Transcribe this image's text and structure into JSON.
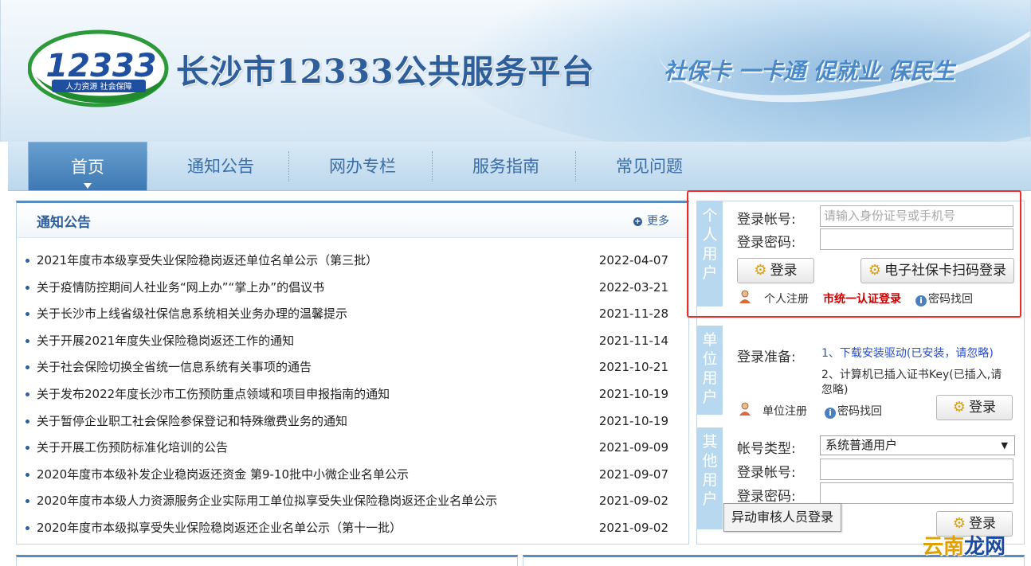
{
  "header": {
    "logo_number": "12333",
    "logo_sub": "人力资源 社会保障",
    "site_title": "长沙市12333公共服务平台",
    "slogan": "社保卡 一卡通 促就业 保民生"
  },
  "nav": {
    "items": [
      {
        "label": "首页",
        "active": true
      },
      {
        "label": "通知公告"
      },
      {
        "label": "网办专栏"
      },
      {
        "label": "服务指南"
      },
      {
        "label": "常见问题"
      }
    ]
  },
  "news": {
    "title": "通知公告",
    "more": "更多",
    "items": [
      {
        "title": "2021年度市本级享受失业保险稳岗返还单位名单公示（第三批）",
        "date": "2022-04-07"
      },
      {
        "title": "关于疫情防控期间人社业务“网上办”“掌上办”的倡议书",
        "date": "2022-03-21"
      },
      {
        "title": "关于长沙市上线省级社保信息系统相关业务办理的温馨提示",
        "date": "2021-11-28"
      },
      {
        "title": "关于开展2021年度失业保险稳岗返还工作的通知",
        "date": "2021-11-14"
      },
      {
        "title": "关于社会保险切换全省统一信息系统有关事项的通告",
        "date": "2021-10-21"
      },
      {
        "title": "关于发布2022年度长沙市工伤预防重点领域和项目申报指南的通知",
        "date": "2021-10-19"
      },
      {
        "title": "关于暂停企业职工社会保险参保登记和特殊缴费业务的通知",
        "date": "2021-10-19"
      },
      {
        "title": "关于开展工伤预防标准化培训的公告",
        "date": "2021-09-09"
      },
      {
        "title": "2020年度市本级补发企业稳岗返还资金 第9-10批中小微企业名单公示",
        "date": "2021-09-07"
      },
      {
        "title": "2020年度市本级人力资源服务企业实际用工单位拟享受失业保险稳岗返还企业名单公示",
        "date": "2021-09-02"
      },
      {
        "title": "2020年度市本级拟享受失业保险稳岗返还企业名单公示（第十一批）",
        "date": "2021-09-02"
      }
    ]
  },
  "personal": {
    "tab": "个人用户",
    "account_label": "登录帐号:",
    "account_placeholder": "请输入身份证号或手机号",
    "password_label": "登录密码:",
    "login_button": "登录",
    "scan_button": "电子社保卡扫码登录",
    "register": "个人注册",
    "unified_login": "市统一认证登录",
    "recover": "密码找回"
  },
  "company": {
    "tab": "单位用户",
    "prep_label": "登录准备:",
    "step1": "1、下载安装驱动(已安装，请忽略)",
    "step2": "2、计算机已插入证书Key(已插入,请忽略)",
    "register": "单位注册",
    "recover": "密码找回",
    "login_button": "登录"
  },
  "other": {
    "tab": "其他用户",
    "type_label": "帐号类型:",
    "type_value": "系统普通用户",
    "account_label": "登录帐号:",
    "password_label": "登录密码:",
    "login_button": "登录",
    "tooltip": "异动审核人员登录"
  },
  "watermark": {
    "part1": "云南",
    "part2": "龙网"
  },
  "colors": {
    "brand": "#2e5f9a",
    "nav_active": "#3d79b4",
    "highlight": "#ef2b2b",
    "link_red": "#cc0000"
  }
}
